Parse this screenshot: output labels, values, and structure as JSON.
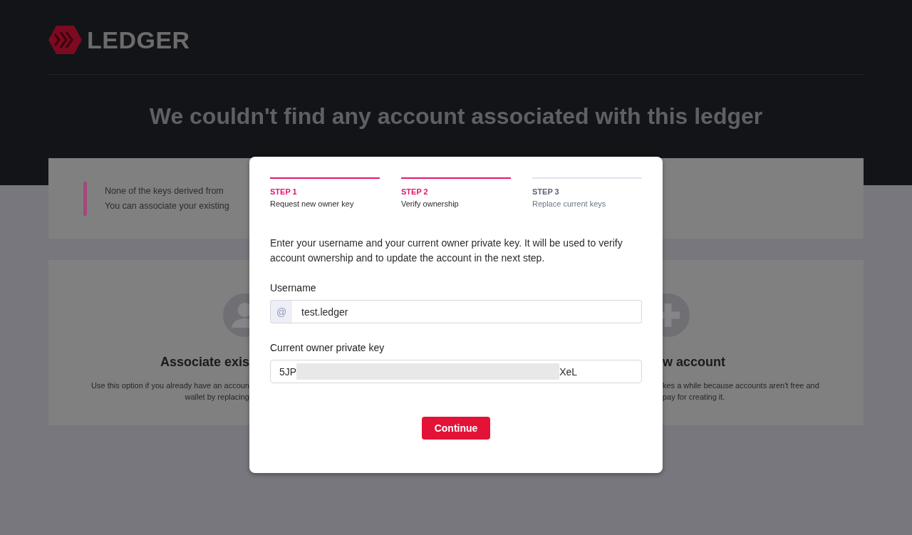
{
  "header": {
    "logo": "LEDGER",
    "heading": "We couldn't find any account associated with this ledger"
  },
  "notice": {
    "lines": [
      "None of the keys derived from",
      "You can associate your existing"
    ]
  },
  "options": [
    {
      "kind": "associate",
      "title": "Associate exis",
      "description": [
        "Use this option if you already have an accoun",
        "wallet by replacing"
      ]
    },
    {
      "kind": "create",
      "title": "w account",
      "description": [
        "kes a while because accounts aren't free and",
        "pay for creating it."
      ]
    }
  ],
  "dialog": {
    "steps": [
      {
        "label": "STEP 1",
        "description": "Request new owner key",
        "active": true
      },
      {
        "label": "STEP 2",
        "description": "Verify ownership",
        "active": true
      },
      {
        "label": "STEP 3",
        "description": "Replace current keys",
        "active": false
      }
    ],
    "intro": "Enter your username and your current owner private key. It will be used to verify account ownership and to update the account in the next step.",
    "fields": [
      {
        "kind": "prefixed",
        "label": "Username",
        "prefix": "@",
        "value": "test.ledger"
      },
      {
        "kind": "redacted",
        "label": "Current owner private key",
        "value_start": "5JP",
        "value_end": "XeL"
      }
    ],
    "button": "Continue"
  }
}
